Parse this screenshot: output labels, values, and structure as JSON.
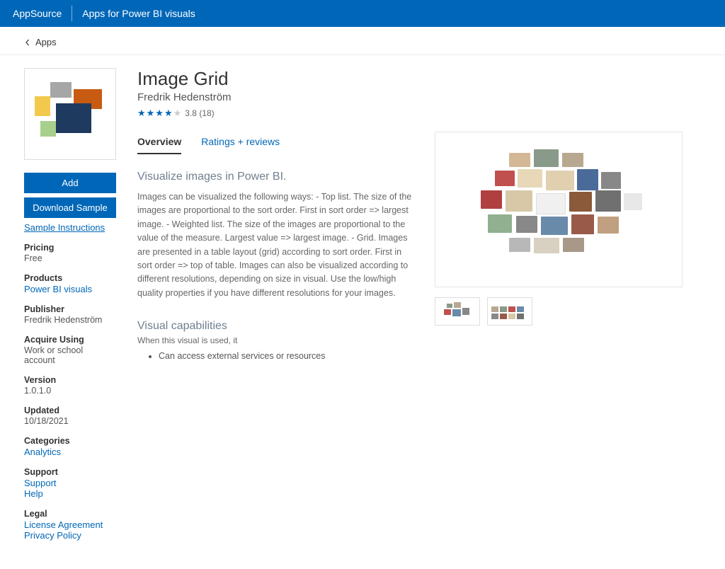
{
  "topbar": {
    "brand": "AppSource",
    "subtitle": "Apps for Power BI visuals"
  },
  "breadcrumb": {
    "back_label": "Apps"
  },
  "app": {
    "title": "Image Grid",
    "author": "Fredrik Hedenström",
    "rating_value": "3.8",
    "rating_count": "(18)"
  },
  "buttons": {
    "add": "Add",
    "download_sample": "Download Sample",
    "sample_instructions": "Sample Instructions"
  },
  "meta": [
    {
      "label": "Pricing",
      "value": "Free",
      "link": false
    },
    {
      "label": "Products",
      "value": "Power BI visuals",
      "link": true
    },
    {
      "label": "Publisher",
      "value": "Fredrik Hedenström",
      "link": false
    },
    {
      "label": "Acquire Using",
      "value": "Work or school account",
      "link": false
    },
    {
      "label": "Version",
      "value": "1.0.1.0",
      "link": false
    },
    {
      "label": "Updated",
      "value": "10/18/2021",
      "link": false
    },
    {
      "label": "Categories",
      "value": "Analytics",
      "link": true
    },
    {
      "label": "Support",
      "value": "Support",
      "value2": "Help",
      "link": true
    },
    {
      "label": "Legal",
      "value": "License Agreement",
      "value2": "Privacy Policy",
      "link": true
    }
  ],
  "tabs": {
    "overview": "Overview",
    "ratings": "Ratings + reviews"
  },
  "overview": {
    "headline": "Visualize images in Power BI.",
    "description": "Images can be visualized the following ways: - Top list. The size of the images are proportional to the sort order. First in sort order => largest image. - Weighted list. The size of the images are proportional to the value of the measure. Largest value => largest image. - Grid. Images are presented in a table layout (grid) according to sort order. First in sort order => top of table. Images can also be visualized according to different resolutions, depending on size in visual. Use the low/high quality properties if you have different resolutions for your images.",
    "capabilities_heading": "Visual capabilities",
    "capabilities_sub": "When this visual is used, it",
    "capabilities": [
      "Can access external services or resources"
    ]
  },
  "icons": {
    "back": "chevron-left-icon"
  }
}
